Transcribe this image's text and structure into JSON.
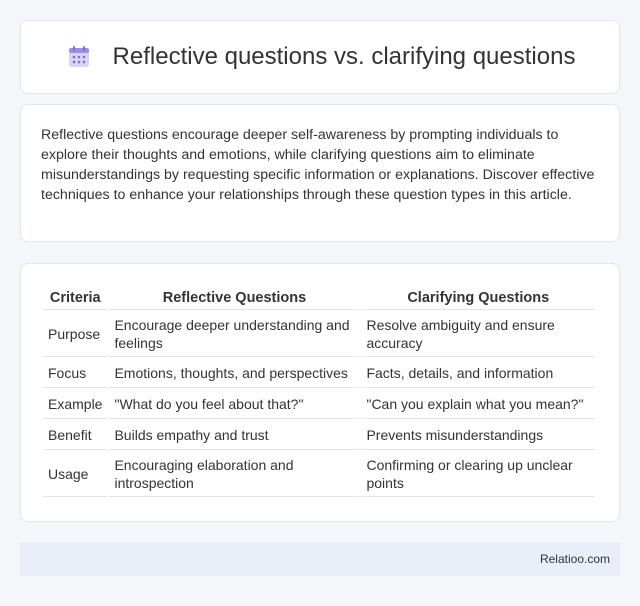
{
  "header": {
    "title": "Reflective questions vs. clarifying questions",
    "icon": "calendar-icon"
  },
  "intro": {
    "text": "Reflective questions encourage deeper self-awareness by prompting individuals to explore their thoughts and emotions, while clarifying questions aim to eliminate misunderstandings by requesting specific information or explanations. Discover effective techniques to enhance your relationships through these question types in this article."
  },
  "table": {
    "headers": [
      "Criteria",
      "Reflective Questions",
      "Clarifying Questions"
    ],
    "rows": [
      [
        "Purpose",
        "Encourage deeper understanding and feelings",
        "Resolve ambiguity and ensure accuracy"
      ],
      [
        "Focus",
        "Emotions, thoughts, and perspectives",
        "Facts, details, and information"
      ],
      [
        "Example",
        "\"What do you feel about that?\"",
        "\"Can you explain what you mean?\""
      ],
      [
        "Benefit",
        "Builds empathy and trust",
        "Prevents misunderstandings"
      ],
      [
        "Usage",
        "Encouraging elaboration and introspection",
        "Confirming or clearing up unclear points"
      ]
    ]
  },
  "footer": {
    "site": "Relatioo.com"
  }
}
